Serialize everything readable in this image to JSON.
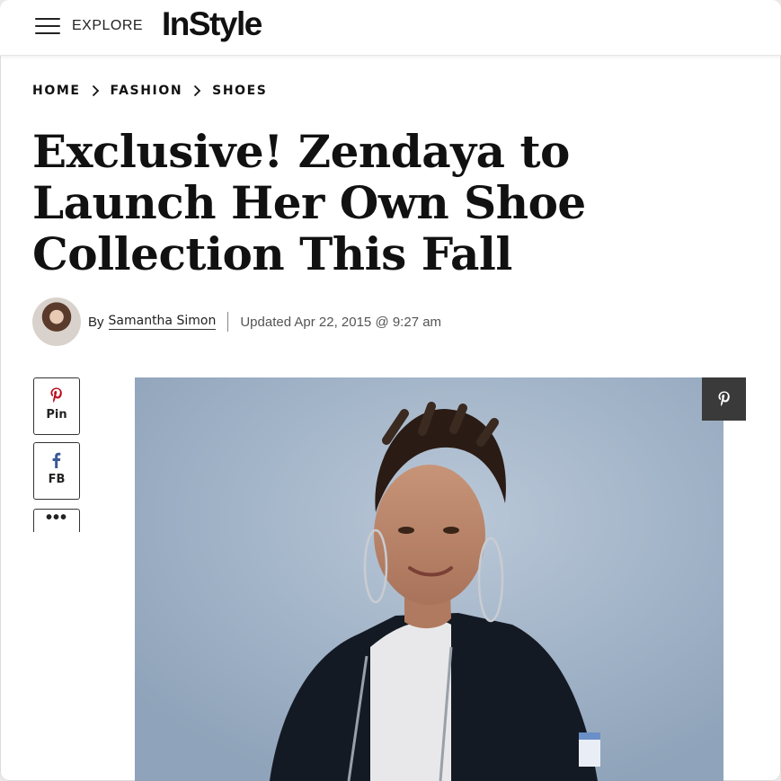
{
  "header": {
    "menu_label": "EXPLORE",
    "logo_text": "InStyle"
  },
  "breadcrumb": {
    "items": [
      {
        "label": "HOME"
      },
      {
        "label": "FASHION"
      },
      {
        "label": "SHOES"
      }
    ]
  },
  "article": {
    "title": "Exclusive! Zendaya to Launch Her Own Shoe Collection This Fall",
    "byline_prefix": "By",
    "author": "Samantha Simon",
    "updated": "Updated Apr 22, 2015 @ 9:27 am"
  },
  "share": {
    "pin_label": "Pin",
    "fb_label": "FB",
    "more_label": "•••"
  },
  "icons": {
    "menu": "hamburger-icon",
    "breadcrumb_separator": "chevron-right-icon",
    "pin": "pinterest-icon",
    "fb": "facebook-icon",
    "more": "more-dots-icon",
    "image_pin": "pinterest-icon"
  },
  "colors": {
    "pinterest": "#bd081c",
    "facebook": "#3b5998",
    "pin_overlay": "#3a3a3a",
    "hero_background": "#9fb2c7"
  }
}
